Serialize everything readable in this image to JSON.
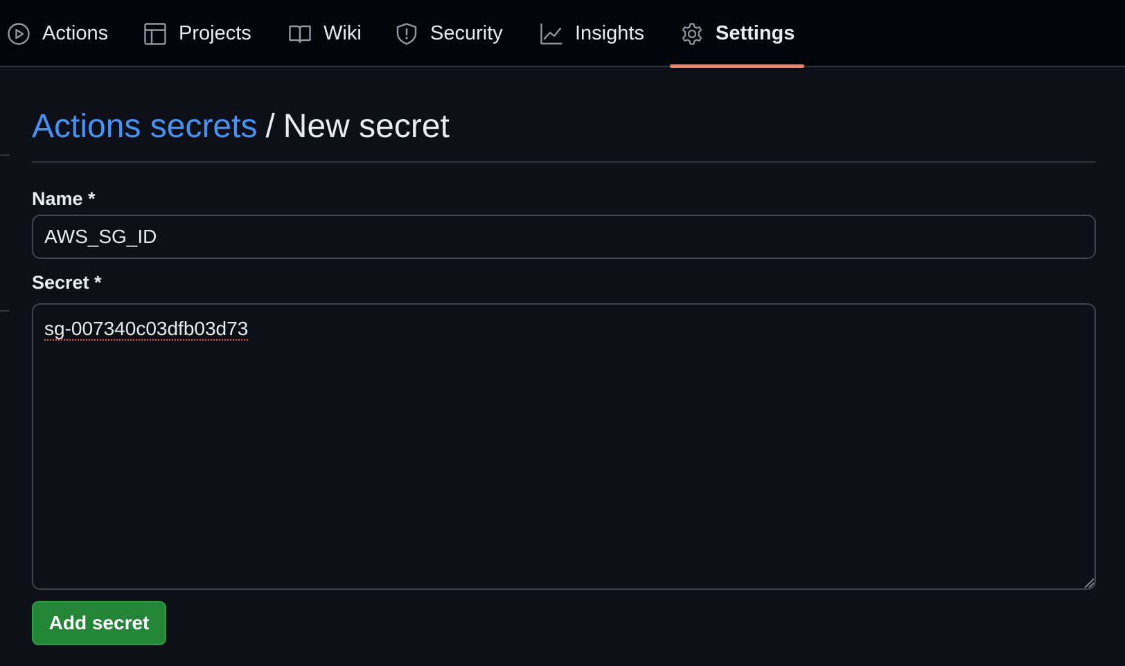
{
  "nav": {
    "tabs": [
      {
        "label": "Actions",
        "icon": "play-circle-icon"
      },
      {
        "label": "Projects",
        "icon": "table-icon"
      },
      {
        "label": "Wiki",
        "icon": "book-icon"
      },
      {
        "label": "Security",
        "icon": "shield-icon"
      },
      {
        "label": "Insights",
        "icon": "graph-icon"
      },
      {
        "label": "Settings",
        "icon": "gear-icon",
        "active": true
      }
    ],
    "accent_color": "#f78166"
  },
  "page": {
    "breadcrumb_link": "Actions secrets",
    "separator": "/",
    "title": "New secret"
  },
  "form": {
    "name_label": "Name *",
    "name_value": "AWS_SG_ID",
    "secret_label": "Secret *",
    "secret_value": "sg-007340c03dfb03d73",
    "submit_label": "Add secret"
  },
  "colors": {
    "background": "#0d1117",
    "link": "#4493f8",
    "button": "#238636"
  }
}
